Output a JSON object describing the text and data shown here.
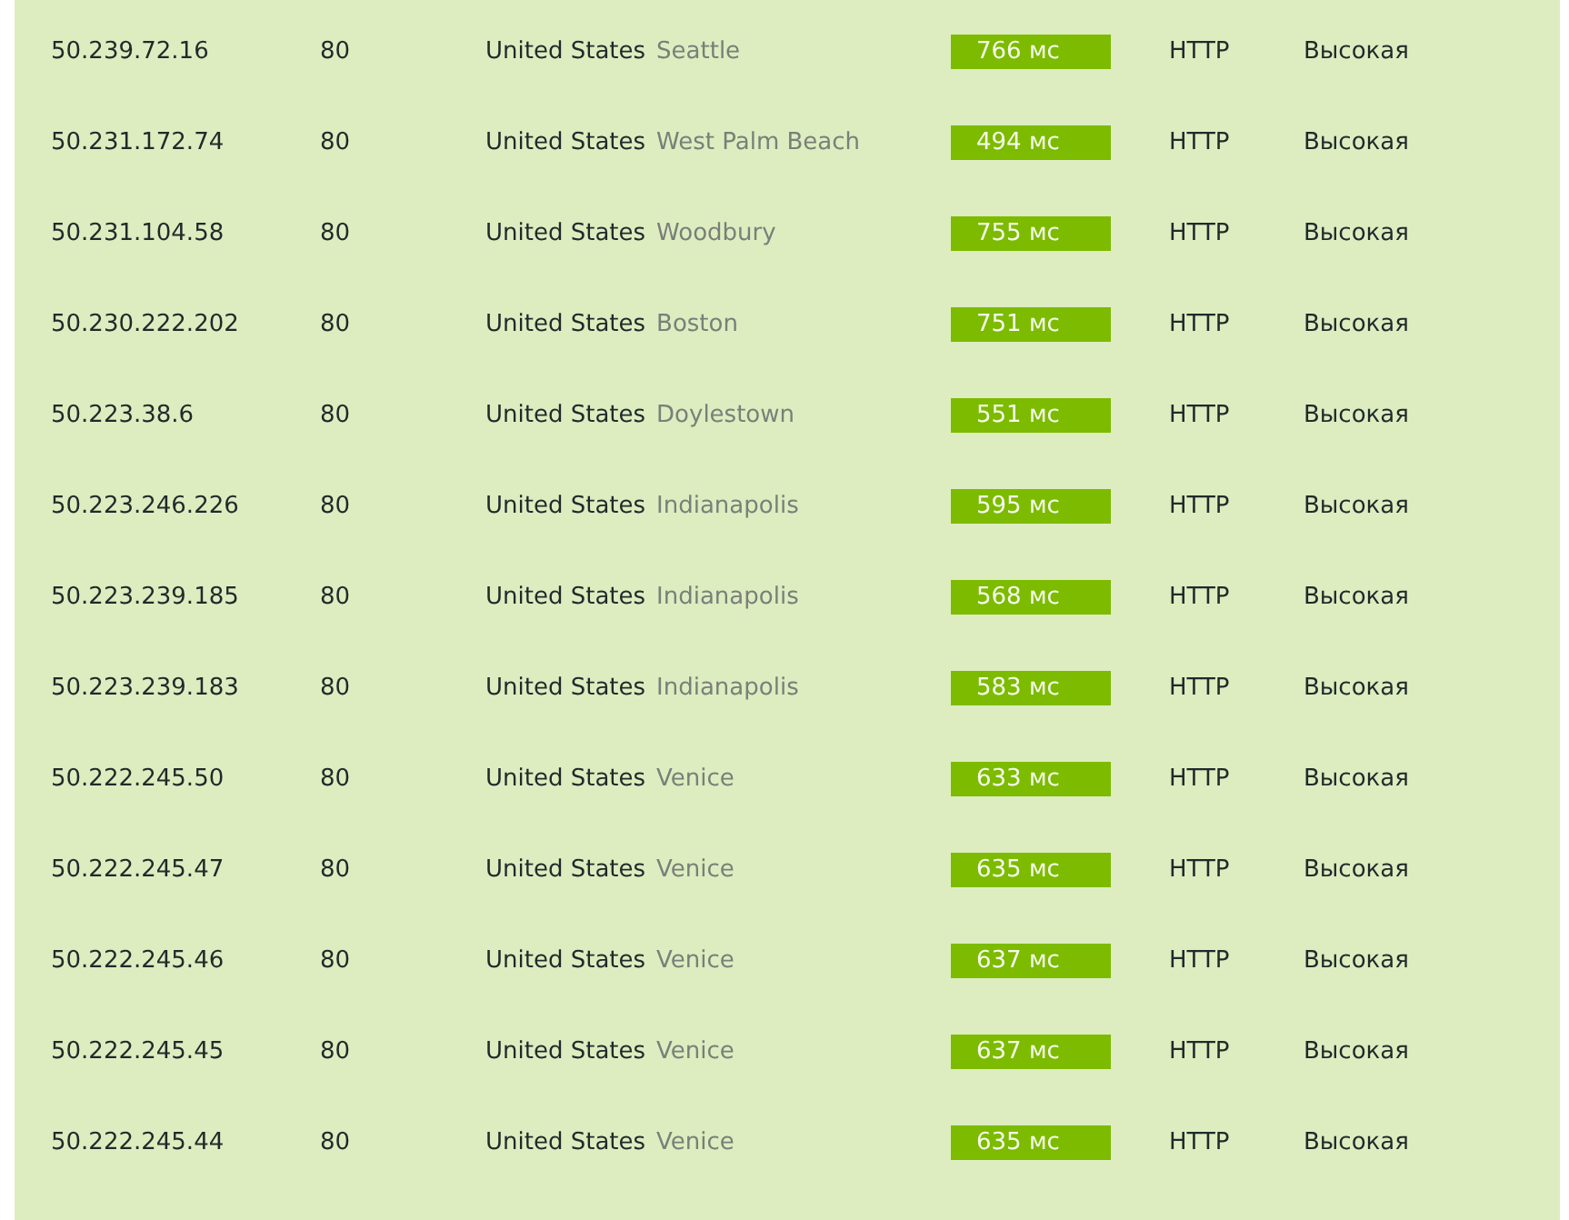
{
  "rows": [
    {
      "ip": "50.239.72.16",
      "port": "80",
      "country": "United States",
      "city": "Seattle",
      "latency": "766 мс",
      "protocol": "HTTP",
      "anonymity": "Высокая"
    },
    {
      "ip": "50.231.172.74",
      "port": "80",
      "country": "United States",
      "city": "West Palm Beach",
      "latency": "494 мс",
      "protocol": "HTTP",
      "anonymity": "Высокая"
    },
    {
      "ip": "50.231.104.58",
      "port": "80",
      "country": "United States",
      "city": "Woodbury",
      "latency": "755 мс",
      "protocol": "HTTP",
      "anonymity": "Высокая"
    },
    {
      "ip": "50.230.222.202",
      "port": "80",
      "country": "United States",
      "city": "Boston",
      "latency": "751 мс",
      "protocol": "HTTP",
      "anonymity": "Высокая"
    },
    {
      "ip": "50.223.38.6",
      "port": "80",
      "country": "United States",
      "city": "Doylestown",
      "latency": "551 мс",
      "protocol": "HTTP",
      "anonymity": "Высокая"
    },
    {
      "ip": "50.223.246.226",
      "port": "80",
      "country": "United States",
      "city": "Indianapolis",
      "latency": "595 мс",
      "protocol": "HTTP",
      "anonymity": "Высокая"
    },
    {
      "ip": "50.223.239.185",
      "port": "80",
      "country": "United States",
      "city": "Indianapolis",
      "latency": "568 мс",
      "protocol": "HTTP",
      "anonymity": "Высокая"
    },
    {
      "ip": "50.223.239.183",
      "port": "80",
      "country": "United States",
      "city": "Indianapolis",
      "latency": "583 мс",
      "protocol": "HTTP",
      "anonymity": "Высокая"
    },
    {
      "ip": "50.222.245.50",
      "port": "80",
      "country": "United States",
      "city": "Venice",
      "latency": "633 мс",
      "protocol": "HTTP",
      "anonymity": "Высокая"
    },
    {
      "ip": "50.222.245.47",
      "port": "80",
      "country": "United States",
      "city": "Venice",
      "latency": "635 мс",
      "protocol": "HTTP",
      "anonymity": "Высокая"
    },
    {
      "ip": "50.222.245.46",
      "port": "80",
      "country": "United States",
      "city": "Venice",
      "latency": "637 мс",
      "protocol": "HTTP",
      "anonymity": "Высокая"
    },
    {
      "ip": "50.222.245.45",
      "port": "80",
      "country": "United States",
      "city": "Venice",
      "latency": "637 мс",
      "protocol": "HTTP",
      "anonymity": "Высокая"
    },
    {
      "ip": "50.222.245.44",
      "port": "80",
      "country": "United States",
      "city": "Venice",
      "latency": "635 мс",
      "protocol": "HTTP",
      "anonymity": "Высокая"
    }
  ]
}
